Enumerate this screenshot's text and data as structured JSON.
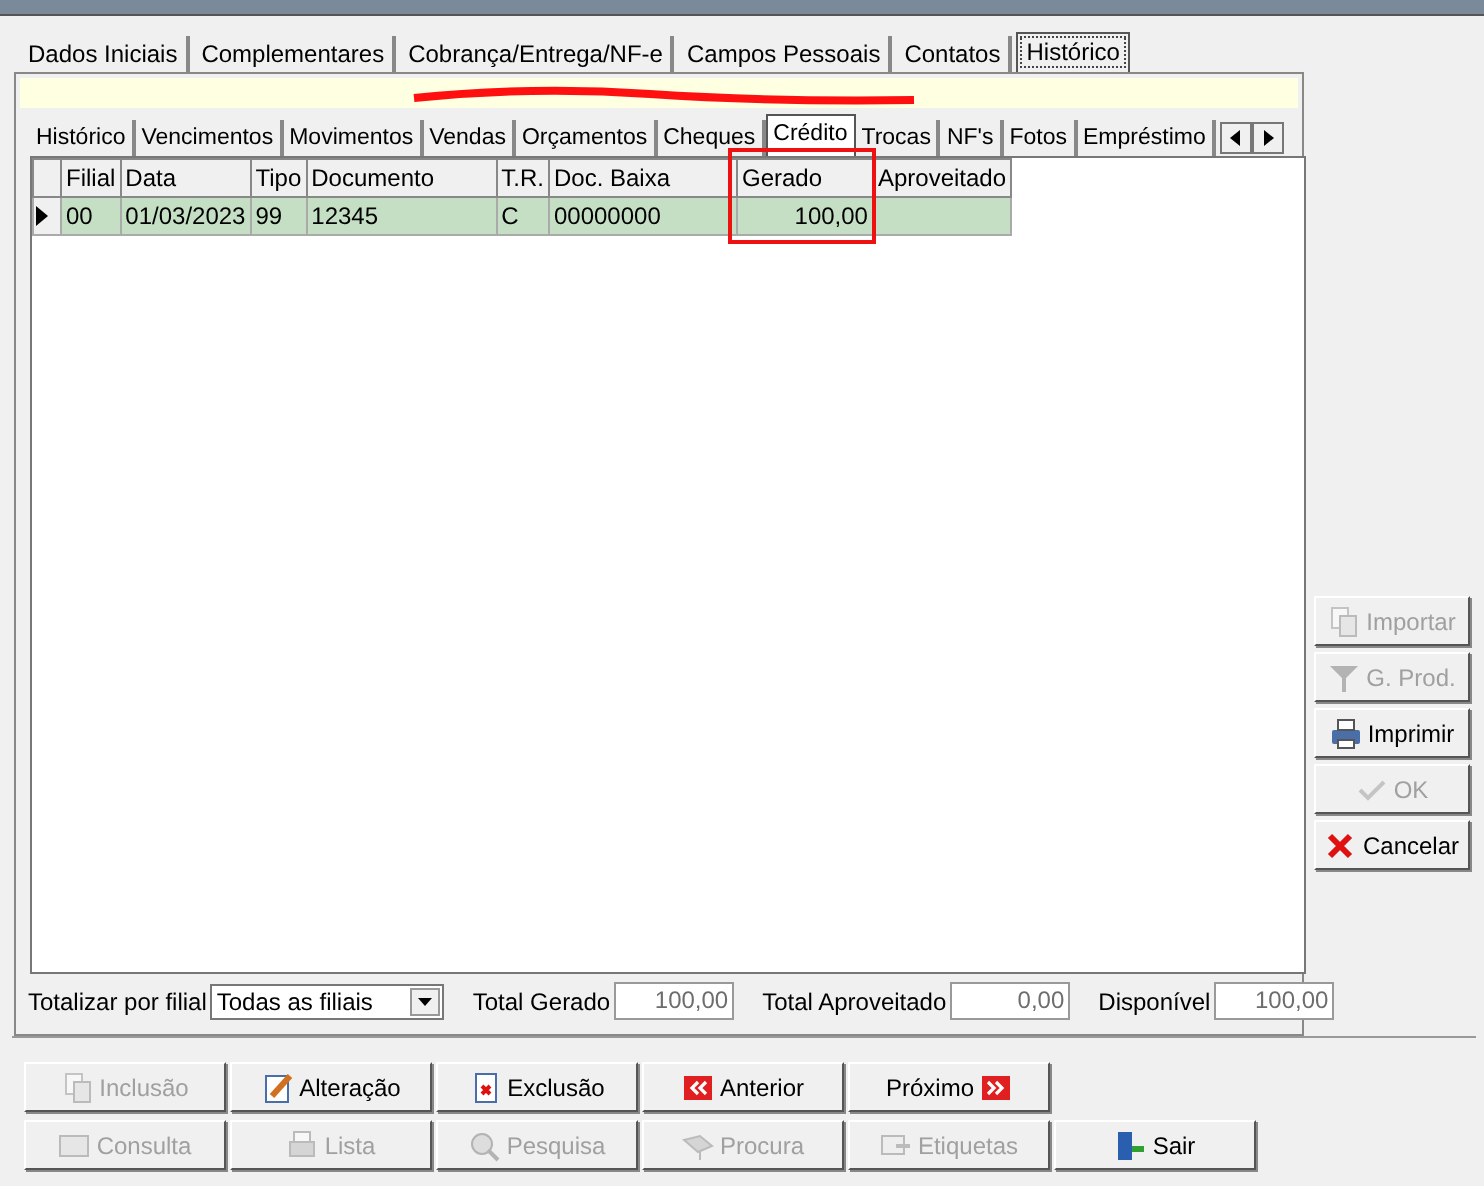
{
  "main_tabs": [
    {
      "label": "Dados Iniciais",
      "selected": false
    },
    {
      "label": "Complementares",
      "selected": false
    },
    {
      "label": "Cobrança/Entrega/NF-e",
      "selected": false
    },
    {
      "label": "Campos Pessoais",
      "selected": false
    },
    {
      "label": "Contatos",
      "selected": false
    },
    {
      "label": "Histórico",
      "selected": true
    }
  ],
  "sub_tabs": [
    {
      "label": "Histórico",
      "selected": false
    },
    {
      "label": "Vencimentos",
      "selected": false
    },
    {
      "label": "Movimentos",
      "selected": false
    },
    {
      "label": "Vendas",
      "selected": false
    },
    {
      "label": "Orçamentos",
      "selected": false
    },
    {
      "label": "Cheques",
      "selected": false
    },
    {
      "label": "Crédito",
      "selected": true
    },
    {
      "label": "Trocas",
      "selected": false
    },
    {
      "label": "NF's",
      "selected": false
    },
    {
      "label": "Fotos",
      "selected": false
    },
    {
      "label": "Empréstimo",
      "selected": false
    }
  ],
  "table": {
    "columns": [
      "Filial",
      "Data",
      "Tipo",
      "Documento",
      "T.R.",
      "Doc. Baixa",
      "Gerado",
      "Aproveitado"
    ],
    "rows": [
      {
        "cells": [
          "00",
          "01/03/2023",
          "99",
          "12345",
          "C",
          "00000000",
          "100,00",
          ""
        ],
        "selected": true
      }
    ]
  },
  "totals": {
    "filter_label": "Totalizar por filial",
    "filter_value": "Todas as filiais",
    "fields": [
      {
        "label": "Total Gerado",
        "value": "100,00"
      },
      {
        "label": "Total Aproveitado",
        "value": "0,00"
      },
      {
        "label": "Disponível",
        "value": "100,00"
      }
    ]
  },
  "side_buttons": [
    {
      "label": "Importar",
      "disabled": true
    },
    {
      "label": "G. Prod.",
      "disabled": true
    },
    {
      "label": "Imprimir",
      "disabled": false
    },
    {
      "label": "OK",
      "disabled": true
    },
    {
      "label": "Cancelar",
      "disabled": false
    }
  ],
  "bottom_buttons": [
    {
      "label": "Inclusão",
      "disabled": true
    },
    {
      "label": "Alteração",
      "disabled": false
    },
    {
      "label": "Exclusão",
      "disabled": false
    },
    {
      "label": "Anterior",
      "disabled": false
    },
    {
      "label": "Próximo",
      "disabled": false
    },
    {
      "label": "Consulta",
      "disabled": true
    },
    {
      "label": "Lista",
      "disabled": true
    },
    {
      "label": "Pesquisa",
      "disabled": true
    },
    {
      "label": "Procura",
      "disabled": true
    },
    {
      "label": "Etiquetas",
      "disabled": true
    },
    {
      "label": "Sair",
      "disabled": false
    }
  ]
}
